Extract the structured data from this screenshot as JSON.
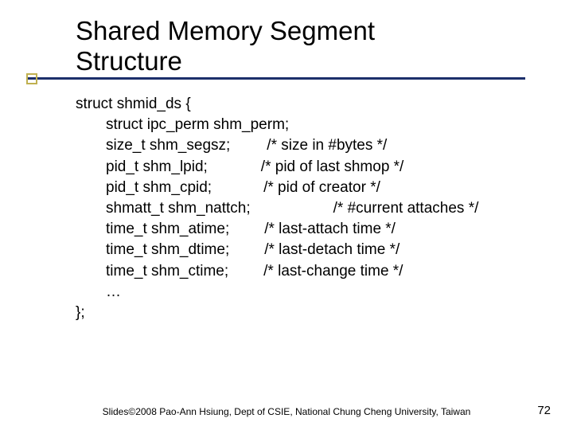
{
  "title": {
    "line1": "Shared Memory Segment",
    "line2": "Structure"
  },
  "struct": {
    "open": "struct shmid_ds {",
    "fields": [
      {
        "decl": "struct ipc_perm shm_perm;",
        "comment": "",
        "pad": 0
      },
      {
        "decl": "size_t shm_segsz;",
        "comment": "/* size in #bytes */",
        "pad": 46
      },
      {
        "decl": "pid_t shm_lpid;",
        "comment": "/* pid of last shmop */",
        "pad": 67
      },
      {
        "decl": "pid_t shm_cpid;",
        "comment": "/* pid of creator */",
        "pad": 65
      },
      {
        "decl": "shmatt_t shm_nattch;",
        "comment": "/* #current attaches */",
        "pad": 104
      },
      {
        "decl": "time_t shm_atime;",
        "comment": "/* last-attach time */",
        "pad": 44
      },
      {
        "decl": "time_t shm_dtime;",
        "comment": "/* last-detach time */",
        "pad": 44
      },
      {
        "decl": "time_t shm_ctime;",
        "comment": "/* last-change time */",
        "pad": 44
      },
      {
        "decl": "…",
        "comment": "",
        "pad": 0
      }
    ],
    "close": "};"
  },
  "footer": "Slides©2008 Pao-Ann Hsiung, Dept of CSIE, National Chung Cheng University, Taiwan",
  "page": "72"
}
